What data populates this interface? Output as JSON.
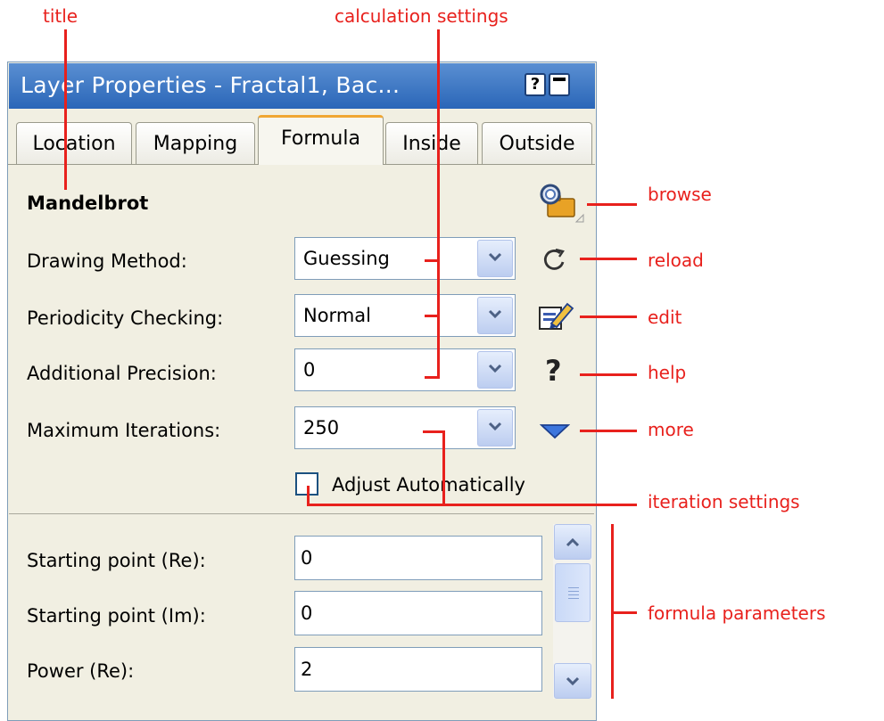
{
  "annotations": {
    "title": "title",
    "calculation_settings": "calculation settings",
    "browse": "browse",
    "reload": "reload",
    "edit": "edit",
    "help": "help",
    "more": "more",
    "iteration_settings": "iteration settings",
    "formula_parameters": "formula parameters"
  },
  "window": {
    "title": "Layer Properties - Fractal1, Bac...",
    "help_button": "?",
    "tabs": [
      "Location",
      "Mapping",
      "Formula",
      "Inside",
      "Outside"
    ],
    "active_tab": "Formula"
  },
  "formula": {
    "name": "Mandelbrot",
    "settings": [
      {
        "label": "Drawing Method:",
        "value": "Guessing"
      },
      {
        "label": "Periodicity Checking:",
        "value": "Normal"
      },
      {
        "label": "Additional Precision:",
        "value": "0"
      },
      {
        "label": "Maximum Iterations:",
        "value": "250"
      }
    ],
    "adjust_checkbox": {
      "label": "Adjust Automatically",
      "checked": false
    },
    "parameters": [
      {
        "label": "Starting point (Re):",
        "value": "0"
      },
      {
        "label": "Starting point (Im):",
        "value": "0"
      },
      {
        "label": "Power (Re):",
        "value": "2"
      }
    ]
  },
  "icons": {
    "browse": "browse-formula-icon",
    "reload": "reload-icon",
    "edit": "edit-icon",
    "help": "help-icon",
    "more": "more-triangle-icon"
  },
  "colors": {
    "annotation": "#e8211d",
    "titlebar": "#2a66b8",
    "active_tab_accent": "#f0a733",
    "panel": "#f1efe2"
  }
}
